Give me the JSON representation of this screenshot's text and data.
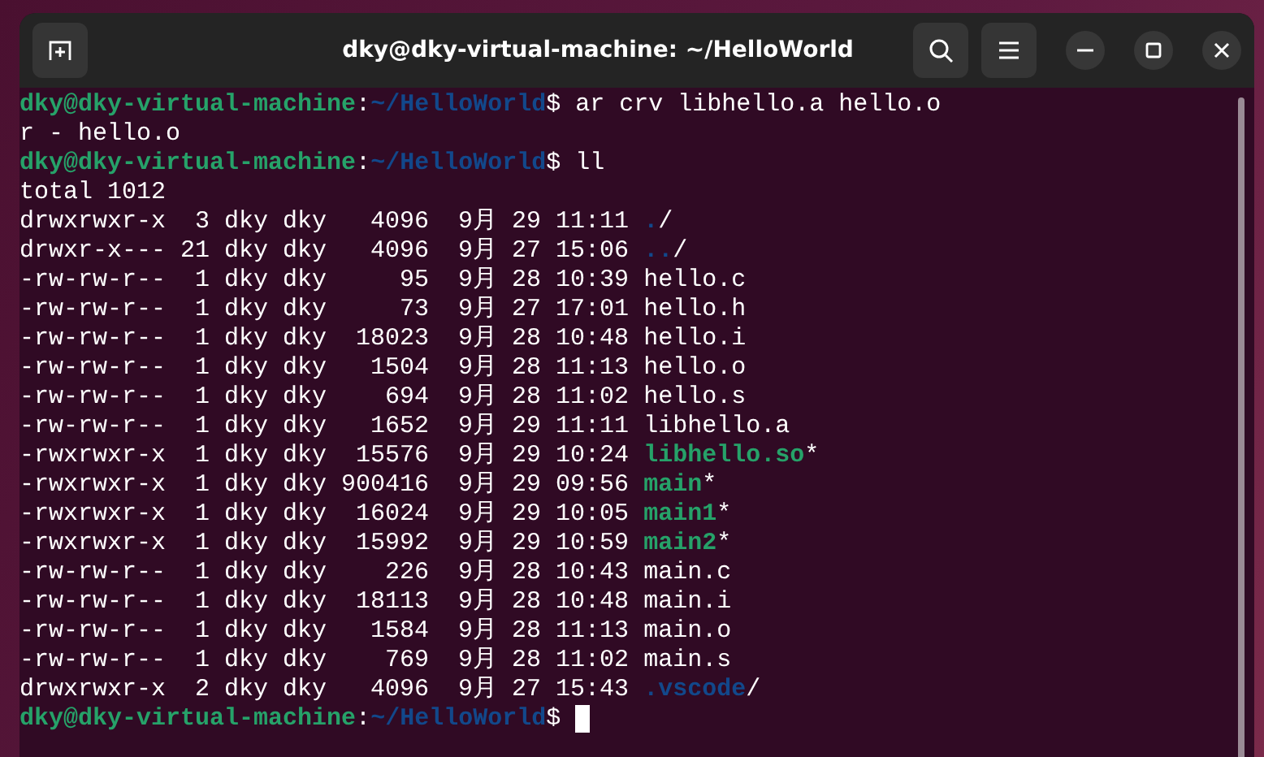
{
  "window": {
    "title": "dky@dky-virtual-machine: ~/HelloWorld"
  },
  "terminal": {
    "lines": [
      {
        "kind": "prompt",
        "user_host": "dky@dky-virtual-machine",
        "separator": ":",
        "path": "~/HelloWorld",
        "symbol": "$",
        "command": "ar crv libhello.a hello.o"
      },
      {
        "kind": "output",
        "text": "r - hello.o"
      },
      {
        "kind": "prompt",
        "user_host": "dky@dky-virtual-machine",
        "separator": ":",
        "path": "~/HelloWorld",
        "symbol": "$",
        "command": "ll"
      },
      {
        "kind": "output",
        "text": "total 1012"
      },
      {
        "kind": "entry",
        "details": "drwxrwxr-x  3 dky dky   4096  9月 29 11:11",
        "file": {
          "kind": "dir",
          "name": ".",
          "suffix": "/"
        }
      },
      {
        "kind": "entry",
        "details": "drwxr-x--- 21 dky dky   4096  9月 27 15:06",
        "file": {
          "kind": "dir",
          "name": "..",
          "suffix": "/"
        }
      },
      {
        "kind": "entry",
        "details": "-rw-rw-r--  1 dky dky     95  9月 28 10:39",
        "file": {
          "kind": "plain",
          "name": "hello.c"
        }
      },
      {
        "kind": "entry",
        "details": "-rw-rw-r--  1 dky dky     73  9月 27 17:01",
        "file": {
          "kind": "plain",
          "name": "hello.h"
        }
      },
      {
        "kind": "entry",
        "details": "-rw-rw-r--  1 dky dky  18023  9月 28 10:48",
        "file": {
          "kind": "plain",
          "name": "hello.i"
        }
      },
      {
        "kind": "entry",
        "details": "-rw-rw-r--  1 dky dky   1504  9月 28 11:13",
        "file": {
          "kind": "plain",
          "name": "hello.o"
        }
      },
      {
        "kind": "entry",
        "details": "-rw-rw-r--  1 dky dky    694  9月 28 11:02",
        "file": {
          "kind": "plain",
          "name": "hello.s"
        }
      },
      {
        "kind": "entry",
        "details": "-rw-rw-r--  1 dky dky   1652  9月 29 11:11",
        "file": {
          "kind": "plain",
          "name": "libhello.a"
        }
      },
      {
        "kind": "entry",
        "details": "-rwxrwxr-x  1 dky dky  15576  9月 29 10:24",
        "file": {
          "kind": "exec",
          "name": "libhello.so",
          "suffix": "*"
        }
      },
      {
        "kind": "entry",
        "details": "-rwxrwxr-x  1 dky dky 900416  9月 29 09:56",
        "file": {
          "kind": "exec",
          "name": "main",
          "suffix": "*"
        }
      },
      {
        "kind": "entry",
        "details": "-rwxrwxr-x  1 dky dky  16024  9月 29 10:05",
        "file": {
          "kind": "exec",
          "name": "main1",
          "suffix": "*"
        }
      },
      {
        "kind": "entry",
        "details": "-rwxrwxr-x  1 dky dky  15992  9月 29 10:59",
        "file": {
          "kind": "exec",
          "name": "main2",
          "suffix": "*"
        }
      },
      {
        "kind": "entry",
        "details": "-rw-rw-r--  1 dky dky    226  9月 28 10:43",
        "file": {
          "kind": "plain",
          "name": "main.c"
        }
      },
      {
        "kind": "entry",
        "details": "-rw-rw-r--  1 dky dky  18113  9月 28 10:48",
        "file": {
          "kind": "plain",
          "name": "main.i"
        }
      },
      {
        "kind": "entry",
        "details": "-rw-rw-r--  1 dky dky   1584  9月 28 11:13",
        "file": {
          "kind": "plain",
          "name": "main.o"
        }
      },
      {
        "kind": "entry",
        "details": "-rw-rw-r--  1 dky dky    769  9月 28 11:02",
        "file": {
          "kind": "plain",
          "name": "main.s"
        }
      },
      {
        "kind": "entry",
        "details": "drwxrwxr-x  2 dky dky   4096  9月 27 15:43",
        "file": {
          "kind": "dir",
          "name": ".vscode",
          "suffix": "/"
        }
      },
      {
        "kind": "prompt",
        "user_host": "dky@dky-virtual-machine",
        "separator": ":",
        "path": "~/HelloWorld",
        "symbol": "$",
        "cursor": true
      }
    ]
  }
}
